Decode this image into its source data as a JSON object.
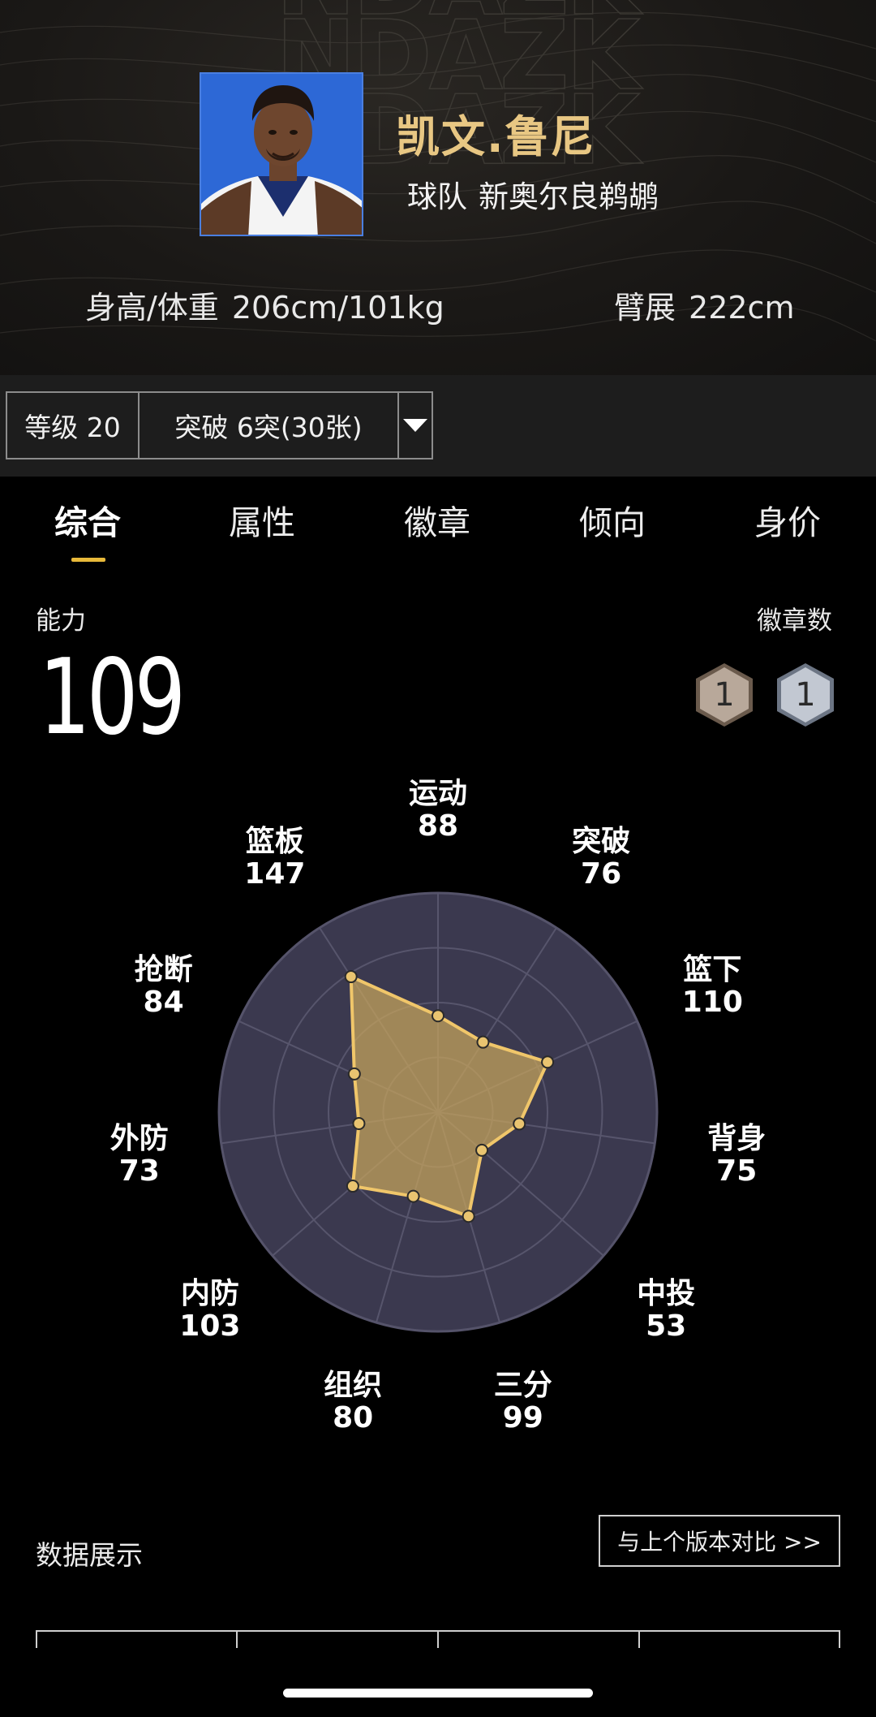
{
  "player": {
    "name": "凯文.鲁尼",
    "team_label": "球队",
    "team_name": "新奥尔良鹈鹕",
    "height_weight_label": "身高/体重",
    "height_weight_value": "206cm/101kg",
    "wingspan_label": "臂展",
    "wingspan_value": "222cm"
  },
  "level_bar": {
    "level": "等级 20",
    "breakthrough": "突破 6突(30张)",
    "dropdown_icon": "caret-down-icon"
  },
  "tabs": [
    {
      "label": "综合",
      "active": true
    },
    {
      "label": "属性",
      "active": false
    },
    {
      "label": "徽章",
      "active": false
    },
    {
      "label": "倾向",
      "active": false
    },
    {
      "label": "身价",
      "active": false
    }
  ],
  "ability": {
    "label": "能力",
    "value": "109",
    "badge_count_label": "徽章数",
    "badges": [
      {
        "tier": "bronze",
        "count": "1",
        "color": "#b8a89a"
      },
      {
        "tier": "silver",
        "count": "1",
        "color": "#c2c8d2"
      }
    ]
  },
  "chart_data": {
    "type": "radar",
    "axes": [
      "运动",
      "突破",
      "篮下",
      "背身",
      "中投",
      "三分",
      "组织",
      "内防",
      "外防",
      "抢断",
      "篮板"
    ],
    "values": [
      88,
      76,
      110,
      75,
      53,
      99,
      80,
      103,
      73,
      84,
      147
    ],
    "value_labels": [
      "88",
      "76",
      "110",
      "75",
      "53",
      "99",
      "80",
      "103",
      "73",
      "84",
      "147"
    ],
    "rings": 4,
    "fill_color": "#c7a55c",
    "stroke_color": "#f0c66a",
    "background_color": "#3b394f"
  },
  "data_section": {
    "title": "数据展示",
    "compare_button": "与上个版本对比 >>"
  }
}
